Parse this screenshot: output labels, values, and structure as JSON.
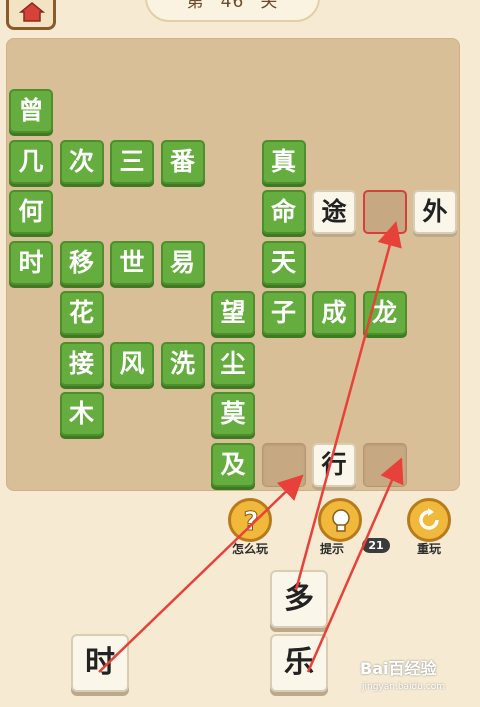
{
  "level": {
    "prefix": "第",
    "number": "46",
    "suffix": "关"
  },
  "board_tiles": [
    {
      "char": "曾",
      "kind": "green",
      "col": 0,
      "row": 0
    },
    {
      "char": "几",
      "kind": "green",
      "col": 0,
      "row": 1
    },
    {
      "char": "次",
      "kind": "green",
      "col": 1,
      "row": 1
    },
    {
      "char": "三",
      "kind": "green",
      "col": 2,
      "row": 1
    },
    {
      "char": "番",
      "kind": "green",
      "col": 3,
      "row": 1
    },
    {
      "char": "真",
      "kind": "green",
      "col": 5,
      "row": 1
    },
    {
      "char": "何",
      "kind": "green",
      "col": 0,
      "row": 2
    },
    {
      "char": "命",
      "kind": "green",
      "col": 5,
      "row": 2
    },
    {
      "char": "途",
      "kind": "white",
      "col": 6,
      "row": 2
    },
    {
      "char": "",
      "kind": "selected",
      "col": 7,
      "row": 2
    },
    {
      "char": "外",
      "kind": "white",
      "col": 8,
      "row": 2
    },
    {
      "char": "时",
      "kind": "green",
      "col": 0,
      "row": 3
    },
    {
      "char": "移",
      "kind": "green",
      "col": 1,
      "row": 3
    },
    {
      "char": "世",
      "kind": "green",
      "col": 2,
      "row": 3
    },
    {
      "char": "易",
      "kind": "green",
      "col": 3,
      "row": 3
    },
    {
      "char": "天",
      "kind": "green",
      "col": 5,
      "row": 3
    },
    {
      "char": "花",
      "kind": "green",
      "col": 1,
      "row": 4
    },
    {
      "char": "望",
      "kind": "green",
      "col": 4,
      "row": 4
    },
    {
      "char": "子",
      "kind": "green",
      "col": 5,
      "row": 4
    },
    {
      "char": "成",
      "kind": "green",
      "col": 6,
      "row": 4
    },
    {
      "char": "龙",
      "kind": "green",
      "col": 7,
      "row": 4
    },
    {
      "char": "接",
      "kind": "green",
      "col": 1,
      "row": 5
    },
    {
      "char": "风",
      "kind": "green",
      "col": 2,
      "row": 5
    },
    {
      "char": "洗",
      "kind": "green",
      "col": 3,
      "row": 5
    },
    {
      "char": "尘",
      "kind": "green",
      "col": 4,
      "row": 5
    },
    {
      "char": "木",
      "kind": "green",
      "col": 1,
      "row": 6
    },
    {
      "char": "莫",
      "kind": "green",
      "col": 4,
      "row": 6
    },
    {
      "char": "及",
      "kind": "green",
      "col": 4,
      "row": 7
    },
    {
      "char": "",
      "kind": "blank",
      "col": 5,
      "row": 7
    },
    {
      "char": "行",
      "kind": "white",
      "col": 6,
      "row": 7
    },
    {
      "char": "",
      "kind": "blank",
      "col": 7,
      "row": 7
    }
  ],
  "buttons": {
    "how_to_play": "怎么玩",
    "hint": "提示",
    "hint_count": "21",
    "replay": "重玩"
  },
  "choices": [
    {
      "char": "多"
    },
    {
      "char": "时"
    },
    {
      "char": "乐"
    }
  ],
  "watermark": {
    "main": "Bai百经验",
    "sub": "jingyan.baidu.com"
  },
  "colors": {
    "green_tile": "#64ad3e",
    "board": "#d8bf97",
    "background": "#f6ebd2",
    "arrow": "#e8413a",
    "selected_border": "#d6403a"
  }
}
